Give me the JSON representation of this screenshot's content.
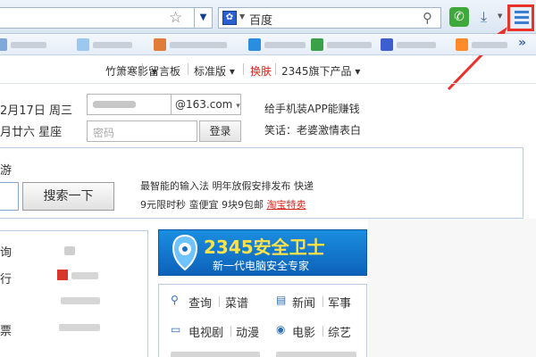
{
  "toolbar": {
    "engine_name": "百度",
    "icons": [
      "star-icon",
      "search-icon",
      "phone-icon",
      "download-icon",
      "menu-list-icon"
    ],
    "colors": {
      "menu_highlight": "#e8322b",
      "phone_green": "#3fa83b"
    }
  },
  "nav": {
    "items": [
      {
        "label": "竹箫寒影",
        "arrow": "▾"
      },
      {
        "label": "留言板",
        "arrow": ""
      },
      {
        "label": "标准版",
        "arrow": "▾"
      },
      {
        "label": "换肤",
        "arrow": ""
      },
      {
        "label": "2345旗下产品",
        "arrow": "▾"
      }
    ]
  },
  "login": {
    "date_line1": "2月17日 周三",
    "date_line2": "月廿六  星座",
    "email_domain": "@163.com",
    "domain_arrow": "▾",
    "password_placeholder": "密码",
    "login_button": "登录",
    "promo_line1": "给手机装APP能赚钱",
    "promo_line2": "笑话：老婆激情表白"
  },
  "search": {
    "section_label": "游",
    "button_label": "搜索一下",
    "quick_line1": "最智能的输入法   明年放假安排发布   快递",
    "quick_line2_a": "9元限时秒   蛮便宜   9块9包邮   ",
    "quick_line2_link": "淘宝特卖"
  },
  "left_list": [
    "询",
    "行",
    "票"
  ],
  "banner": {
    "title": "2345安全卫士",
    "subtitle": "新一代电脑安全专家"
  },
  "grid": {
    "row1": [
      {
        "a": "查询",
        "b": "菜谱",
        "icon": "search-icon"
      },
      {
        "a": "新闻",
        "b": "军事",
        "icon": "news-icon"
      }
    ],
    "row2": [
      {
        "a": "电视剧",
        "b": "动漫",
        "icon": "tv-icon"
      },
      {
        "a": "电影",
        "b": "综艺",
        "icon": "film-icon"
      }
    ]
  }
}
